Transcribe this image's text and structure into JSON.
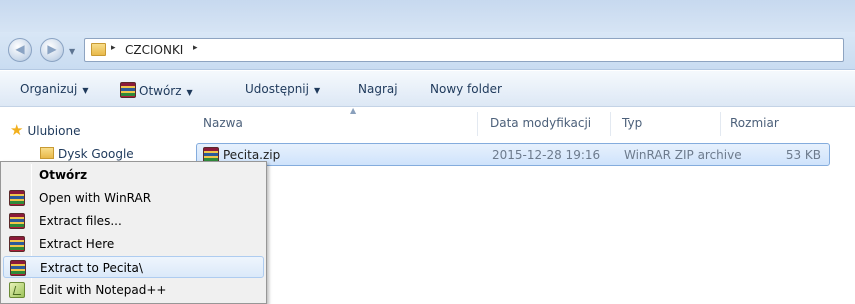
{
  "address": {
    "path_segments": [
      "CZCIONKI"
    ],
    "separator": "▸"
  },
  "toolbar": {
    "organize": "Organizuj",
    "open": "Otwórz",
    "share": "Udostępnij",
    "burn": "Nagraj",
    "new_folder": "Nowy folder"
  },
  "nav_pane": {
    "favorites": "Ulubione",
    "items": [
      "Dysk Google"
    ]
  },
  "columns": {
    "name": "Nazwa",
    "date": "Data modyfikacji",
    "type": "Typ",
    "size": "Rozmiar"
  },
  "files": [
    {
      "name": "Pecita.zip",
      "date": "2015-12-28 19:16",
      "type": "WinRAR ZIP archive",
      "size": "53 KB"
    }
  ],
  "context_menu": {
    "items": [
      {
        "label": "Otwórz",
        "icon": "none",
        "bold": true
      },
      {
        "label": "Open with WinRAR",
        "icon": "winrar-icon"
      },
      {
        "label": "Extract files...",
        "icon": "winrar-icon"
      },
      {
        "label": "Extract Here",
        "icon": "winrar-icon"
      },
      {
        "label": "Extract to Pecita\\",
        "icon": "winrar-icon",
        "highlighted": true
      },
      {
        "label": "Edit with Notepad++",
        "icon": "notepad-plus-plus-icon"
      }
    ]
  },
  "colors": {
    "selection_bg": "#cfe3fb",
    "selection_border": "#84acdd",
    "menu_bg": "#f0f0f0"
  }
}
